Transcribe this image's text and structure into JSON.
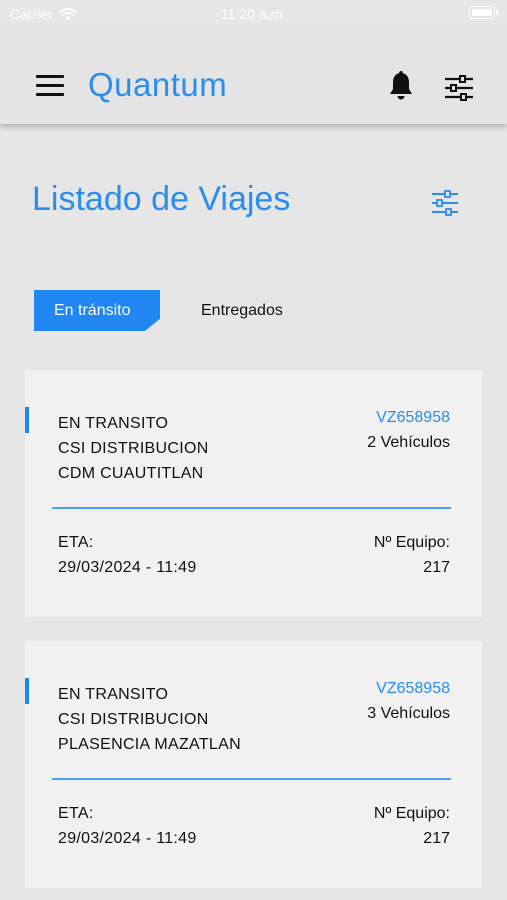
{
  "status_bar": {
    "carrier": "Carrier",
    "time": "11:20 a.m."
  },
  "header": {
    "brand": "Quantum",
    "brand_color": "#2a8df0",
    "menu_icon": "hamburger-menu-icon",
    "notification_icon": "bell-icon",
    "filter_icon": "sliders-icon"
  },
  "page": {
    "title": "Listado de Viajes",
    "filter_icon": "sliders-icon"
  },
  "tabs": [
    {
      "label": "En tránsito",
      "active": true
    },
    {
      "label": "Entregados",
      "active": false
    }
  ],
  "trips": [
    {
      "status": "EN TRANSITO",
      "origin": "CSI DISTRIBUCION",
      "destination": "CDM CUAUTITLAN",
      "trip_id": "VZ658958",
      "vehicles": "2 Vehículos",
      "eta_label": "ETA:",
      "eta_value": "29/03/2024 - 11:49",
      "equipment_label": "Nº Equipo:",
      "equipment_value": "217"
    },
    {
      "status": "EN TRANSITO",
      "origin": "CSI DISTRIBUCION",
      "destination": "PLASENCIA MAZATLAN",
      "trip_id": "VZ658958",
      "vehicles": "3 Vehículos",
      "eta_label": "ETA:",
      "eta_value": "29/03/2024 - 11:49",
      "equipment_label": "Nº Equipo:",
      "equipment_value": "217"
    }
  ],
  "colors": {
    "accent": "#1f86f2",
    "background": "#e6e6e6",
    "card": "#f1f1f1"
  }
}
